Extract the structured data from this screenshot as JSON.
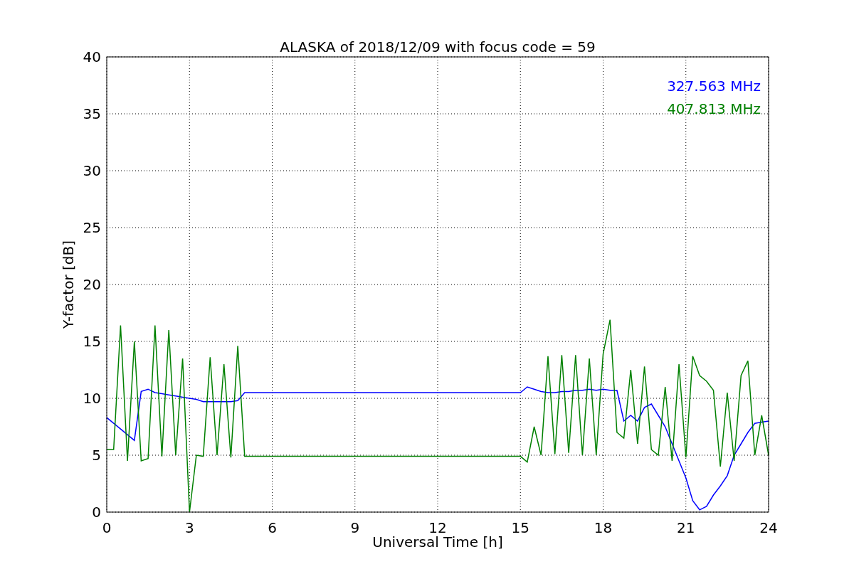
{
  "figure": {
    "chart_data": {
      "type": "line",
      "title": "ALASKA of 2018/12/09 with focus code = 59",
      "xlabel": "Universal Time [h]",
      "ylabel": "Y-factor [dB]",
      "x": [
        0,
        0.25,
        0.5,
        0.75,
        1,
        1.25,
        1.5,
        1.75,
        2,
        2.25,
        2.5,
        2.75,
        3,
        3.25,
        3.5,
        3.75,
        4,
        4.25,
        4.5,
        4.75,
        5,
        15,
        15.25,
        15.5,
        15.75,
        16,
        16.25,
        16.5,
        16.75,
        17,
        17.25,
        17.5,
        17.75,
        18,
        18.25,
        18.5,
        18.75,
        19,
        19.25,
        19.5,
        19.75,
        20,
        20.25,
        20.5,
        20.75,
        21,
        21.25,
        21.5,
        21.75,
        22,
        22.25,
        22.5,
        22.75,
        23,
        23.25,
        23.5,
        23.75,
        24
      ],
      "series": [
        {
          "name": "327.563 MHz",
          "color": "#0000ff",
          "values": [
            8.3,
            7.8,
            7.3,
            6.8,
            6.3,
            10.6,
            10.8,
            10.5,
            10.4,
            10.3,
            10.2,
            10.1,
            10.0,
            9.9,
            9.7,
            9.7,
            9.7,
            9.7,
            9.7,
            9.8,
            10.5,
            10.5,
            11.0,
            10.8,
            10.6,
            10.5,
            10.5,
            10.6,
            10.6,
            10.7,
            10.7,
            10.8,
            10.7,
            10.8,
            10.7,
            10.7,
            8.0,
            8.5,
            8.0,
            9.2,
            9.5,
            8.5,
            7.5,
            6.0,
            4.5,
            3.0,
            1.0,
            0.2,
            0.5,
            1.5,
            2.3,
            3.2,
            5.0,
            6.0,
            7.0,
            7.8,
            7.9,
            8.0
          ]
        },
        {
          "name": "407.813 MHz",
          "color": "#008000",
          "values": [
            5.5,
            5.5,
            16.4,
            4.5,
            15.0,
            4.5,
            4.7,
            16.4,
            4.9,
            16.0,
            5.0,
            13.5,
            0.0,
            5.0,
            4.9,
            13.6,
            5.0,
            13.0,
            4.8,
            14.6,
            4.9,
            4.9,
            4.4,
            7.5,
            5.0,
            13.7,
            5.1,
            13.8,
            5.2,
            13.8,
            5.0,
            13.5,
            5.0,
            13.9,
            16.9,
            7.0,
            6.5,
            12.5,
            6.0,
            12.8,
            5.5,
            5.0,
            11.0,
            4.5,
            13.0,
            4.8,
            13.7,
            12.0,
            11.5,
            10.7,
            4.0,
            10.5,
            4.5,
            12.0,
            13.3,
            5.0,
            8.5,
            5.0
          ]
        }
      ],
      "xlim": [
        0,
        24
      ],
      "ylim": [
        0,
        40
      ],
      "xticks": [
        0,
        3,
        6,
        9,
        12,
        15,
        18,
        21,
        24
      ],
      "yticks": [
        0,
        5,
        10,
        15,
        20,
        25,
        30,
        35,
        40
      ],
      "grid": true
    }
  }
}
